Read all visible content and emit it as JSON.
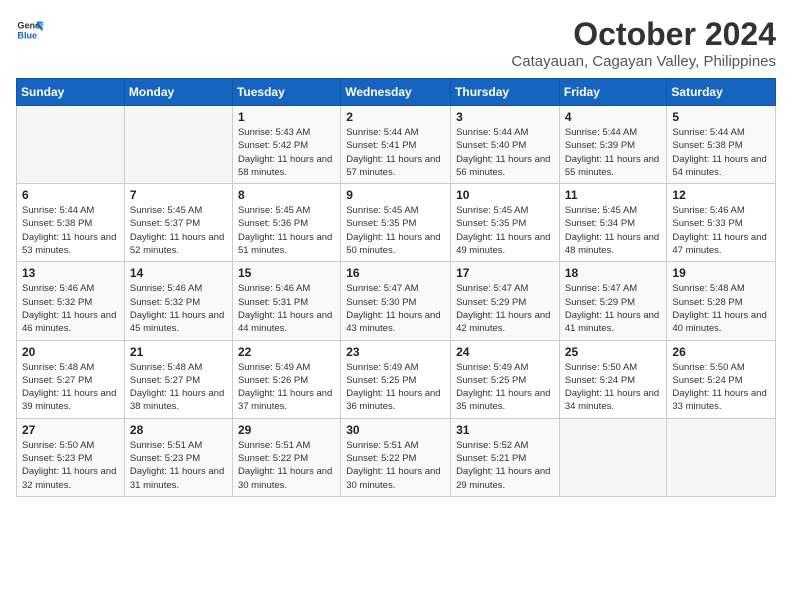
{
  "logo": {
    "line1": "General",
    "line2": "Blue"
  },
  "title": "October 2024",
  "location": "Catayauan, Cagayan Valley, Philippines",
  "weekdays": [
    "Sunday",
    "Monday",
    "Tuesday",
    "Wednesday",
    "Thursday",
    "Friday",
    "Saturday"
  ],
  "weeks": [
    [
      {
        "day": "",
        "empty": true
      },
      {
        "day": "",
        "empty": true
      },
      {
        "day": "1",
        "sunrise": "5:43 AM",
        "sunset": "5:42 PM",
        "daylight": "11 hours and 58 minutes."
      },
      {
        "day": "2",
        "sunrise": "5:44 AM",
        "sunset": "5:41 PM",
        "daylight": "11 hours and 57 minutes."
      },
      {
        "day": "3",
        "sunrise": "5:44 AM",
        "sunset": "5:40 PM",
        "daylight": "11 hours and 56 minutes."
      },
      {
        "day": "4",
        "sunrise": "5:44 AM",
        "sunset": "5:39 PM",
        "daylight": "11 hours and 55 minutes."
      },
      {
        "day": "5",
        "sunrise": "5:44 AM",
        "sunset": "5:38 PM",
        "daylight": "11 hours and 54 minutes."
      }
    ],
    [
      {
        "day": "6",
        "sunrise": "5:44 AM",
        "sunset": "5:38 PM",
        "daylight": "11 hours and 53 minutes."
      },
      {
        "day": "7",
        "sunrise": "5:45 AM",
        "sunset": "5:37 PM",
        "daylight": "11 hours and 52 minutes."
      },
      {
        "day": "8",
        "sunrise": "5:45 AM",
        "sunset": "5:36 PM",
        "daylight": "11 hours and 51 minutes."
      },
      {
        "day": "9",
        "sunrise": "5:45 AM",
        "sunset": "5:35 PM",
        "daylight": "11 hours and 50 minutes."
      },
      {
        "day": "10",
        "sunrise": "5:45 AM",
        "sunset": "5:35 PM",
        "daylight": "11 hours and 49 minutes."
      },
      {
        "day": "11",
        "sunrise": "5:45 AM",
        "sunset": "5:34 PM",
        "daylight": "11 hours and 48 minutes."
      },
      {
        "day": "12",
        "sunrise": "5:46 AM",
        "sunset": "5:33 PM",
        "daylight": "11 hours and 47 minutes."
      }
    ],
    [
      {
        "day": "13",
        "sunrise": "5:46 AM",
        "sunset": "5:32 PM",
        "daylight": "11 hours and 46 minutes."
      },
      {
        "day": "14",
        "sunrise": "5:46 AM",
        "sunset": "5:32 PM",
        "daylight": "11 hours and 45 minutes."
      },
      {
        "day": "15",
        "sunrise": "5:46 AM",
        "sunset": "5:31 PM",
        "daylight": "11 hours and 44 minutes."
      },
      {
        "day": "16",
        "sunrise": "5:47 AM",
        "sunset": "5:30 PM",
        "daylight": "11 hours and 43 minutes."
      },
      {
        "day": "17",
        "sunrise": "5:47 AM",
        "sunset": "5:29 PM",
        "daylight": "11 hours and 42 minutes."
      },
      {
        "day": "18",
        "sunrise": "5:47 AM",
        "sunset": "5:29 PM",
        "daylight": "11 hours and 41 minutes."
      },
      {
        "day": "19",
        "sunrise": "5:48 AM",
        "sunset": "5:28 PM",
        "daylight": "11 hours and 40 minutes."
      }
    ],
    [
      {
        "day": "20",
        "sunrise": "5:48 AM",
        "sunset": "5:27 PM",
        "daylight": "11 hours and 39 minutes."
      },
      {
        "day": "21",
        "sunrise": "5:48 AM",
        "sunset": "5:27 PM",
        "daylight": "11 hours and 38 minutes."
      },
      {
        "day": "22",
        "sunrise": "5:49 AM",
        "sunset": "5:26 PM",
        "daylight": "11 hours and 37 minutes."
      },
      {
        "day": "23",
        "sunrise": "5:49 AM",
        "sunset": "5:25 PM",
        "daylight": "11 hours and 36 minutes."
      },
      {
        "day": "24",
        "sunrise": "5:49 AM",
        "sunset": "5:25 PM",
        "daylight": "11 hours and 35 minutes."
      },
      {
        "day": "25",
        "sunrise": "5:50 AM",
        "sunset": "5:24 PM",
        "daylight": "11 hours and 34 minutes."
      },
      {
        "day": "26",
        "sunrise": "5:50 AM",
        "sunset": "5:24 PM",
        "daylight": "11 hours and 33 minutes."
      }
    ],
    [
      {
        "day": "27",
        "sunrise": "5:50 AM",
        "sunset": "5:23 PM",
        "daylight": "11 hours and 32 minutes."
      },
      {
        "day": "28",
        "sunrise": "5:51 AM",
        "sunset": "5:23 PM",
        "daylight": "11 hours and 31 minutes."
      },
      {
        "day": "29",
        "sunrise": "5:51 AM",
        "sunset": "5:22 PM",
        "daylight": "11 hours and 30 minutes."
      },
      {
        "day": "30",
        "sunrise": "5:51 AM",
        "sunset": "5:22 PM",
        "daylight": "11 hours and 30 minutes."
      },
      {
        "day": "31",
        "sunrise": "5:52 AM",
        "sunset": "5:21 PM",
        "daylight": "11 hours and 29 minutes."
      },
      {
        "day": "",
        "empty": true
      },
      {
        "day": "",
        "empty": true
      }
    ]
  ]
}
